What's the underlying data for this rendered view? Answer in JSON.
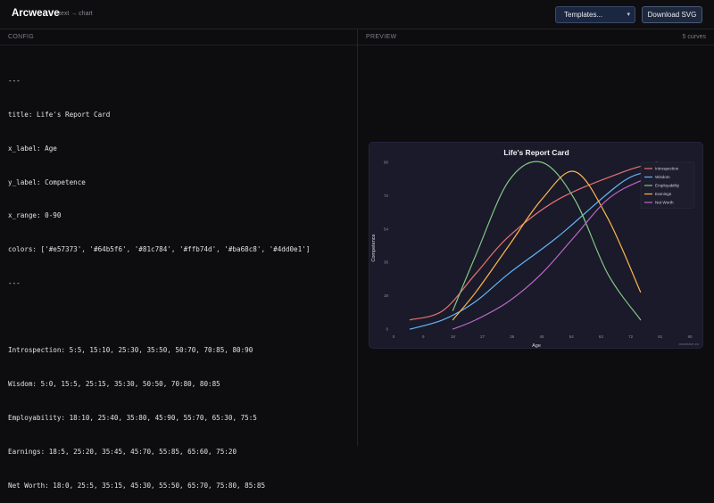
{
  "app": {
    "name": "Arcweave",
    "tagline": "text → chart"
  },
  "toolbar": {
    "templates_label": "Templates...",
    "download_label": "Download SVG"
  },
  "config_pane": {
    "header": "CONFIG",
    "lines": [
      "---",
      "title: Life's Report Card",
      "x_label: Age",
      "y_label: Competence",
      "x_range: 0-90",
      "colors: ['#e57373', '#64b5f6', '#81c784', '#ffb74d', '#ba68c8', '#4dd0e1']",
      "---",
      "",
      "Introspection: 5:5, 15:10, 25:30, 35:50, 50:70, 70:85, 80:90",
      "Wisdom: 5:0, 15:5, 25:15, 35:30, 50:50, 70:80, 80:85",
      "Employability: 18:10, 25:40, 35:80, 45:90, 55:70, 65:30, 75:5",
      "Earnings: 18:5, 25:20, 35:45, 45:70, 55:85, 65:60, 75:20",
      "Net Worth: 18:0, 25:5, 35:15, 45:30, 55:50, 65:70, 75:80, 85:85"
    ]
  },
  "preview_pane": {
    "header": "PREVIEW",
    "curve_count": "5 curves",
    "watermark": "arcweave.co"
  },
  "chart_data": {
    "type": "line",
    "title": "Life's Report Card",
    "xlabel": "Age",
    "ylabel": "Competence",
    "xlim": [
      0,
      90
    ],
    "ylim": [
      0,
      90
    ],
    "x_ticks": [
      0,
      9,
      18,
      27,
      36,
      45,
      54,
      63,
      72,
      81,
      90
    ],
    "y_ticks": [
      0,
      18,
      36,
      54,
      72,
      90
    ],
    "y_tick_labels": [
      "0",
      "18",
      "36",
      "54",
      "72",
      "90"
    ],
    "x_tick_labels": [
      "0",
      "9",
      "18",
      "27",
      "36",
      "45",
      "54",
      "63",
      "72",
      "81",
      "90"
    ],
    "legend_position": "top-right",
    "series": [
      {
        "name": "Introspection",
        "color": "#e57373",
        "points": [
          [
            5,
            5
          ],
          [
            15,
            10
          ],
          [
            25,
            30
          ],
          [
            35,
            50
          ],
          [
            50,
            70
          ],
          [
            70,
            85
          ],
          [
            80,
            90
          ]
        ]
      },
      {
        "name": "Wisdom",
        "color": "#64b5f6",
        "points": [
          [
            5,
            0
          ],
          [
            15,
            5
          ],
          [
            25,
            15
          ],
          [
            35,
            30
          ],
          [
            50,
            50
          ],
          [
            70,
            80
          ],
          [
            80,
            85
          ]
        ]
      },
      {
        "name": "Employability",
        "color": "#81c784",
        "points": [
          [
            18,
            10
          ],
          [
            25,
            40
          ],
          [
            35,
            80
          ],
          [
            45,
            90
          ],
          [
            55,
            70
          ],
          [
            65,
            30
          ],
          [
            75,
            5
          ]
        ]
      },
      {
        "name": "Earnings",
        "color": "#ffb74d",
        "points": [
          [
            18,
            5
          ],
          [
            25,
            20
          ],
          [
            35,
            45
          ],
          [
            45,
            70
          ],
          [
            55,
            85
          ],
          [
            65,
            60
          ],
          [
            75,
            20
          ]
        ]
      },
      {
        "name": "Net Worth",
        "color": "#ba68c8",
        "points": [
          [
            18,
            0
          ],
          [
            25,
            5
          ],
          [
            35,
            15
          ],
          [
            45,
            30
          ],
          [
            55,
            50
          ],
          [
            65,
            70
          ],
          [
            75,
            80
          ],
          [
            85,
            85
          ]
        ]
      }
    ]
  }
}
